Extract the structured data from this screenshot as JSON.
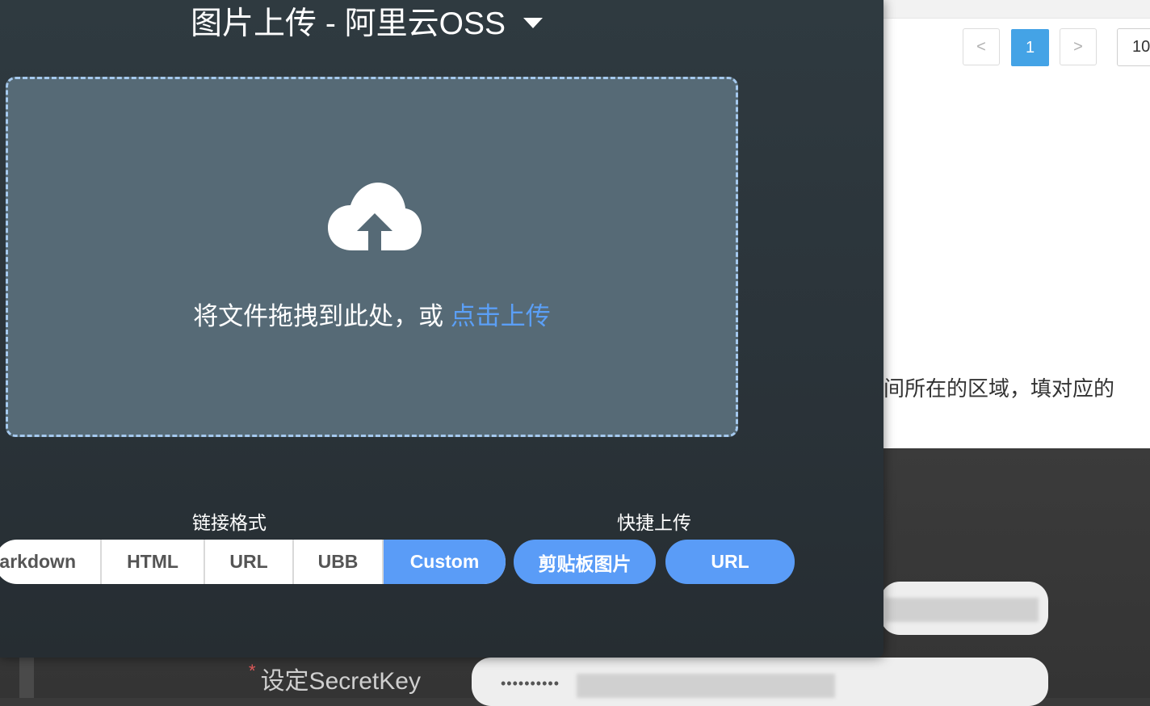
{
  "header": {
    "title": "图片上传 - 阿里云OSS"
  },
  "dropzone": {
    "text": "将文件拖拽到此处，或 ",
    "link": "点击上传"
  },
  "link_format": {
    "label": "链接格式",
    "options": [
      "Markdown",
      "HTML",
      "URL",
      "UBB",
      "Custom"
    ],
    "selected": "Custom"
  },
  "quick_upload": {
    "label": "快捷上传",
    "clipboard": "剪贴板图片",
    "url": "URL"
  },
  "background": {
    "pager": {
      "prev": "<",
      "current": "1",
      "next": ">",
      "page_size": "10"
    },
    "hint_text": "间所在的区域，填对应的",
    "secret_key_label": "设定SecretKey",
    "secret_key_value": "••••••••••",
    "required_mark": "*"
  },
  "colors": {
    "accent": "#5a9cf7",
    "panel": "#2f3a40",
    "dropzone": "#566a76",
    "dropzone_border": "#a5c9ee",
    "pager_active": "#44a3e6"
  },
  "icons": {
    "upload": "cloud-upload-icon",
    "dropdown": "caret-down-icon"
  }
}
